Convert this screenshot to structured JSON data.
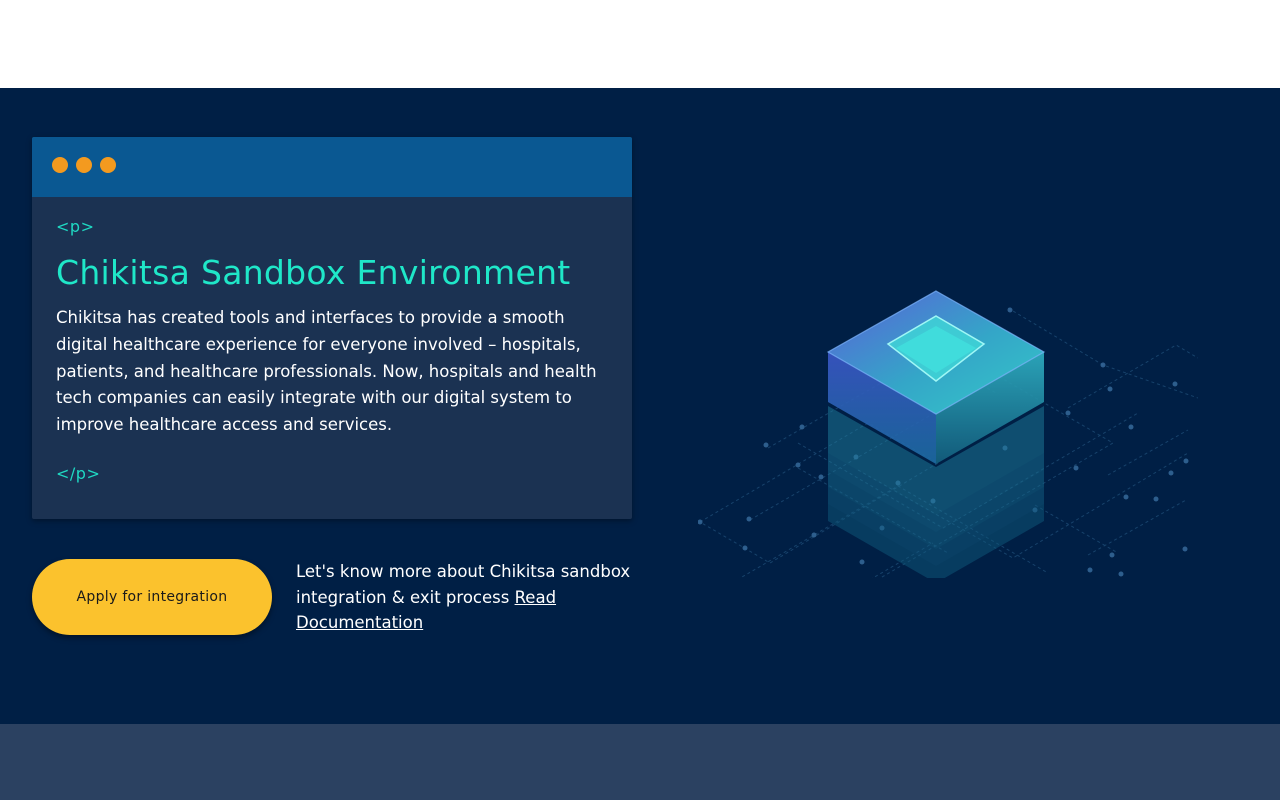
{
  "page": {
    "colors": {
      "header_bg": "#ffffff",
      "hero_bg": "#001f45",
      "card_bg": "#1b3252",
      "card_header_bg": "#0a5892",
      "dot": "#f39a1f",
      "accent_teal": "#1fe7c8",
      "button_bg": "#fbc22d",
      "footer_bg": "#2b4161"
    }
  },
  "card": {
    "open_tag": "<p>",
    "title": "Chikitsa Sandbox Environment",
    "body": "Chikitsa has created tools and interfaces to provide a smooth digital healthcare experience for everyone involved – hospitals, patients, and healthcare professionals. Now, hospitals and health tech companies can easily integrate with our digital system to improve healthcare access and services.",
    "close_tag": "</p>"
  },
  "cta": {
    "apply_label": "Apply for integration",
    "doc_text": "Let's know more about Chikitsa sandbox integration & exit process ",
    "doc_link_label": "Read Documentation"
  },
  "illustration": {
    "icon": "isometric-stack-illustration"
  }
}
